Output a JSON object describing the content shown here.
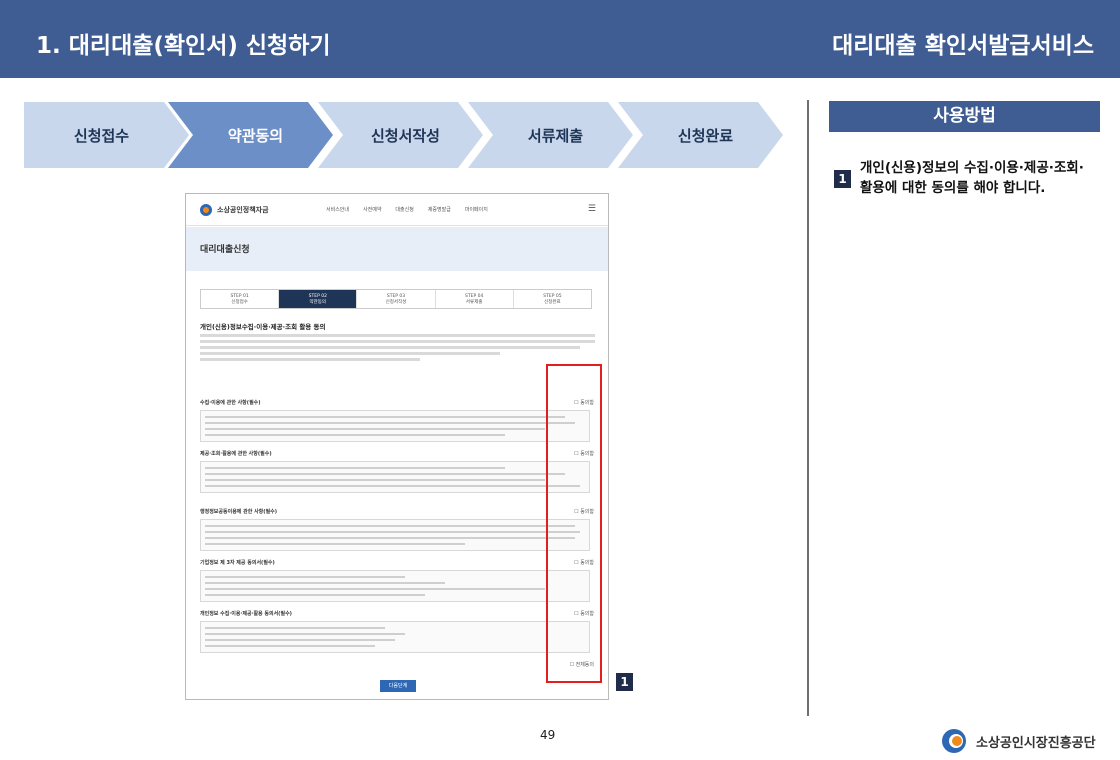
{
  "header": {
    "title": "1. 대리대출(확인서) 신청하기",
    "service": "대리대출 확인서발급서비스"
  },
  "steps": [
    "신청접수",
    "약관동의",
    "신청서작성",
    "서류제출",
    "신청완료"
  ],
  "active_step": 1,
  "usage": {
    "title": "사용방법",
    "badge": "1",
    "text": "개인(신용)정보의 수집·이용·제공·조회·활용에 대한 동의를 해야 합니다."
  },
  "screenshot": {
    "logo": "소상공인정책자금",
    "menu": [
      "서비스안내",
      "사전예약",
      "대출신청",
      "제증명발급",
      "마이페이지"
    ],
    "title": "대리대출신청",
    "steps": [
      {
        "no": "STEP 01",
        "label": "신청접수"
      },
      {
        "no": "STEP 02",
        "label": "약관동의"
      },
      {
        "no": "STEP 03",
        "label": "신청서작성"
      },
      {
        "no": "STEP 04",
        "label": "서류제출"
      },
      {
        "no": "STEP 05",
        "label": "신청완료"
      }
    ],
    "heading": "개인(신용)정보수집·이용·제공·조회 활용 동의",
    "sections": [
      "수집·이용에 관한 사항(필수)",
      "제공·조회·활용에 관한 사항(필수)",
      "행정정보공동이용에 관한 사항(필수)",
      "기업정보 제 3자 제공 동의서(필수)",
      "개인정보 수집·이용·제공·활용 동의서(필수)"
    ],
    "agree": "동의함",
    "agree_all": "전체동의",
    "next_button": "다음단계"
  },
  "callout_badge": "1",
  "page_number": "49",
  "footer": {
    "org": "소상공인시장진흥공단"
  },
  "colors": {
    "header": "#3f5d93",
    "step_active": "#6d8fc7",
    "step_inactive": "#c8d7ec",
    "highlight": "#e31e1e"
  }
}
